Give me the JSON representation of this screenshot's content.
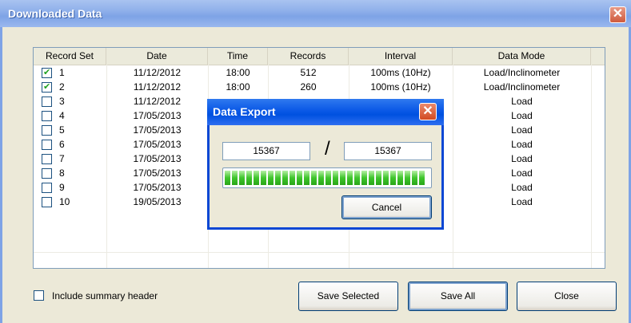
{
  "window": {
    "title": "Downloaded Data",
    "close_glyph": "✕"
  },
  "table": {
    "headers": [
      "Record Set",
      "Date",
      "Time",
      "Records",
      "Interval",
      "Data Mode"
    ],
    "rows": [
      {
        "checked": true,
        "set": "1",
        "date": "11/12/2012",
        "time": "18:00",
        "records": "512",
        "interval": "100ms (10Hz)",
        "mode": "Load/Inclinometer"
      },
      {
        "checked": true,
        "set": "2",
        "date": "11/12/2012",
        "time": "18:00",
        "records": "260",
        "interval": "100ms (10Hz)",
        "mode": "Load/Inclinometer"
      },
      {
        "checked": false,
        "set": "3",
        "date": "11/12/2012",
        "time": "",
        "records": "",
        "interval": "",
        "mode": "Load"
      },
      {
        "checked": false,
        "set": "4",
        "date": "17/05/2013",
        "time": "",
        "records": "",
        "interval": "",
        "mode": "Load"
      },
      {
        "checked": false,
        "set": "5",
        "date": "17/05/2013",
        "time": "",
        "records": "",
        "interval": "",
        "mode": "Load"
      },
      {
        "checked": false,
        "set": "6",
        "date": "17/05/2013",
        "time": "",
        "records": "",
        "interval": "",
        "mode": "Load"
      },
      {
        "checked": false,
        "set": "7",
        "date": "17/05/2013",
        "time": "",
        "records": "",
        "interval": "",
        "mode": "Load"
      },
      {
        "checked": false,
        "set": "8",
        "date": "17/05/2013",
        "time": "",
        "records": "",
        "interval": "",
        "mode": "Load"
      },
      {
        "checked": false,
        "set": "9",
        "date": "17/05/2013",
        "time": "",
        "records": "",
        "interval": "",
        "mode": "Load"
      },
      {
        "checked": false,
        "set": "10",
        "date": "19/05/2013",
        "time": "",
        "records": "",
        "interval": "",
        "mode": "Load"
      }
    ]
  },
  "options": {
    "summary_header_label": "Include summary header"
  },
  "buttons": {
    "save_selected": "Save Selected",
    "save_all": "Save All",
    "close": "Close"
  },
  "export_dialog": {
    "title": "Data Export",
    "current": "15367",
    "total": "15367",
    "separator": "/",
    "progress_fraction": 1.0,
    "cancel_label": "Cancel",
    "close_glyph": "✕"
  }
}
